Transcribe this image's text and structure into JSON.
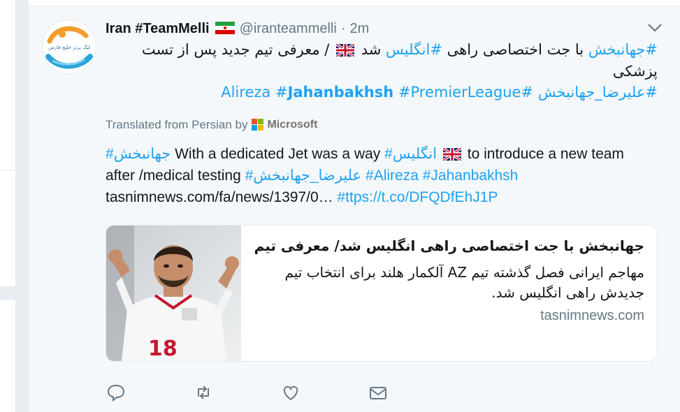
{
  "tweet": {
    "display_name": "Iran #TeamMelli",
    "handle": "@iranteammelli",
    "separator": "·",
    "time": "2m",
    "avatar_logo_text": "لیگ برتر خلیج فارس",
    "text_line1": {
      "tag1": "#جهانبخش",
      "t1": " با جت اختصاصی راهی ",
      "tag2": "#انگلیس",
      "t2": " شد ",
      "t3": " / معرفی تیم جدید پس از تست"
    },
    "text_line2": "پزشکی",
    "text_line3": {
      "tag1": "#علیرضا_جهانبخش",
      "tag2": "#Alireza",
      "tag3_hash": "#",
      "tag3_bold": "Jahanbakhsh",
      "tag4": "#PremierLeague"
    },
    "translated_label": "Translated from Persian by",
    "translator": "Microsoft",
    "translation": {
      "tag1": "#جهانبخش",
      "t1": " With a dedicated Jet was a way ",
      "tag2": "#انگلیس",
      "t2": " to introduce a new team",
      "t3": "after /medical testing ",
      "tag3": "#علیرضا_جهانبخش",
      "tag4": "#Alireza",
      "tag5": "#Jahanbakhsh",
      "link1": "tasnimnews.com/fa/news/1397/0…",
      "link2": "#ttps://t.co/DFQDfEhJ1P"
    },
    "card": {
      "title": "جهانبخش با جت اختصاصی راهی انگلیس شد/ معرفی تیم جدی ..",
      "description": "مهاجم ایرانی فصل گذشته تیم AZ آلکمار هلند برای انتخاب تیم جدیدش راهی انگلیس شد.",
      "domain": "tasnimnews.com",
      "jersey_number": "18"
    },
    "actions": [
      "reply-icon",
      "retweet-icon",
      "like-icon",
      "message-icon"
    ]
  },
  "colors": {
    "link": "#1da1f2",
    "muted": "#657786",
    "text": "#14171a",
    "background": "#e6ecf0",
    "tweet_bg": "#f5f8fa"
  }
}
